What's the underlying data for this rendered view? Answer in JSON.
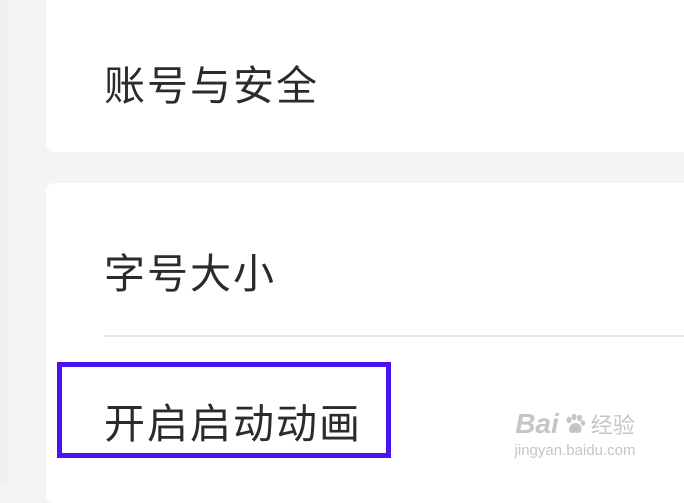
{
  "settings": {
    "account_security_label": "账号与安全",
    "font_size_label": "字号大小",
    "launch_animation_label": "开启启动动画"
  },
  "highlight": {
    "color": "#4a14f0",
    "target": "launch_animation_label"
  },
  "watermark": {
    "brand": "Bai",
    "service": "经验",
    "url": "jingyan.baidu.com",
    "icon": "paw-icon"
  },
  "colors": {
    "background": "#f4f4f4",
    "card": "#ffffff",
    "text": "#2b2b2b",
    "divider": "#e6e6e6"
  }
}
